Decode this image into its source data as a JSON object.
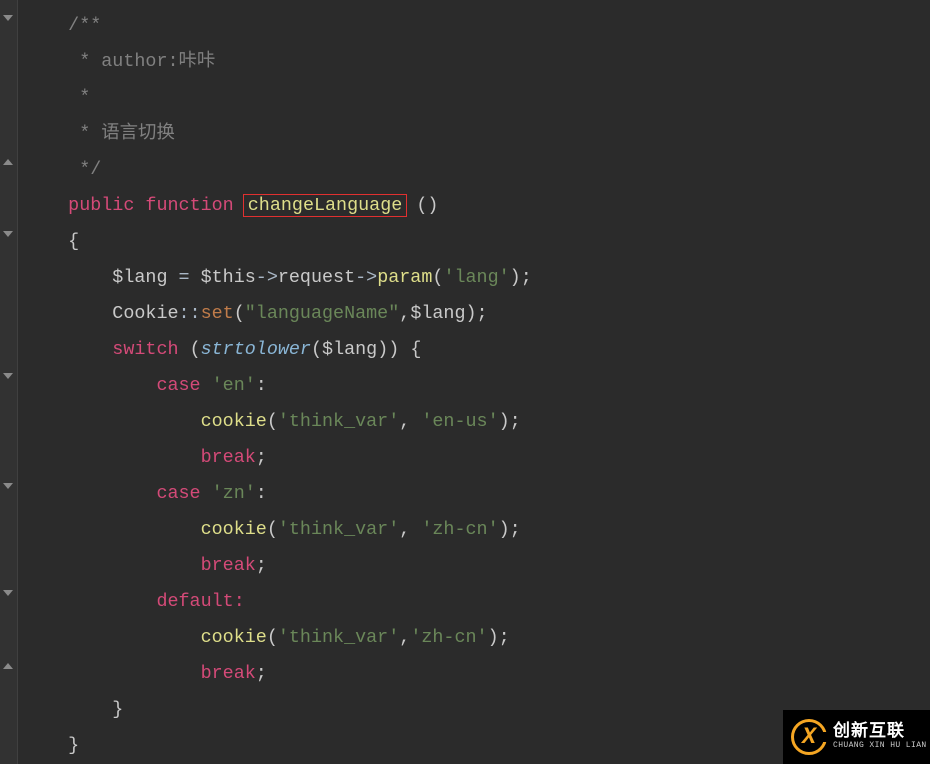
{
  "code": {
    "comment_start": "/**",
    "comment_author_label": " * author:",
    "comment_author_value": "咔咔",
    "comment_blank": " *",
    "comment_desc_prefix": " * ",
    "comment_desc": "语言切换",
    "comment_end": " */",
    "kw_public": "public",
    "kw_function": "function",
    "fn_name": "changeLanguage",
    "paren_open": "(",
    "paren_close": ")",
    "brace_open": "{",
    "brace_close": "}",
    "var_lang": "$lang",
    "op_assign": " = ",
    "var_this": "$this",
    "arrow": "->",
    "member_request": "request",
    "fn_param": "param",
    "str_lang_key": "'lang'",
    "semi": ";",
    "cls_cookie": "Cookie",
    "dbl_colon": "::",
    "fn_set": "set",
    "str_languageName": "\"languageName\"",
    "comma": ",",
    "kw_switch": "switch",
    "fn_strtolower": "strtolower",
    "kw_case": "case",
    "str_en": "'en'",
    "colon": ":",
    "fn_cookie": "cookie",
    "str_think_var": "'think_var'",
    "str_en_us": "'en-us'",
    "kw_break": "break",
    "str_zn": "'zn'",
    "str_zh_cn": "'zh-cn'",
    "kw_default": "default"
  },
  "logo": {
    "letter": "X",
    "title": "创新互联",
    "subtitle": "CHUANG XIN HU LIAN"
  },
  "fold_positions": [
    12,
    156,
    228,
    370,
    480,
    587,
    660
  ]
}
